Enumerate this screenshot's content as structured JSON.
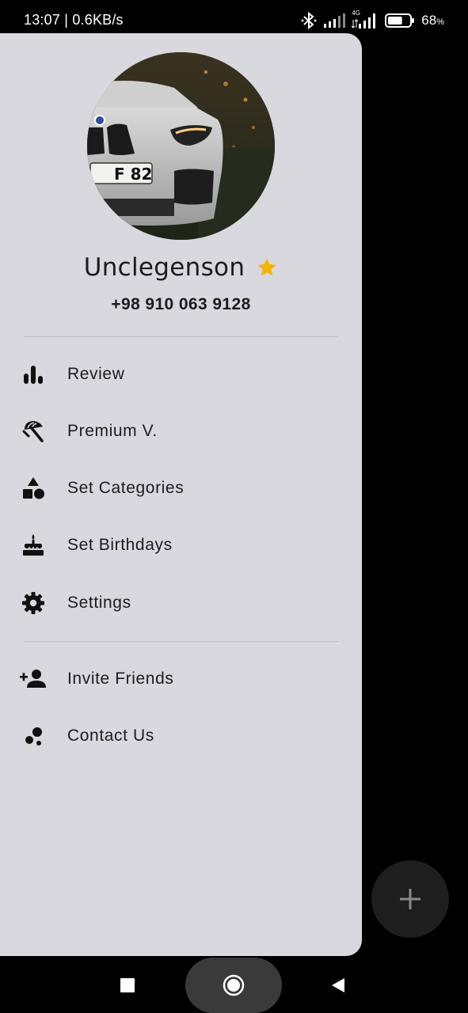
{
  "status_bar": {
    "time": "13:07 | 0.6KB/s",
    "network_label": "4G",
    "battery_percent": "68",
    "battery_unit": "%",
    "battery_level": 0.68
  },
  "profile": {
    "name": "Unclegenson",
    "phone": "+98 910 063 9128",
    "avatar_plate": "F 82",
    "star_color": "#f4b400"
  },
  "menu": {
    "primary": [
      {
        "label": "Review",
        "icon": "bar-chart-icon"
      },
      {
        "label": "Premium V.",
        "icon": "beach-umbrella-icon"
      },
      {
        "label": "Set Categories",
        "icon": "category-shapes-icon"
      },
      {
        "label": "Set Birthdays",
        "icon": "cake-icon"
      },
      {
        "label": "Settings",
        "icon": "gear-icon"
      }
    ],
    "secondary": [
      {
        "label": "Invite Friends",
        "icon": "person-add-icon"
      },
      {
        "label": "Contact Us",
        "icon": "bubble-chart-icon"
      }
    ]
  },
  "fab": {
    "icon": "plus-icon"
  },
  "nav_bar": {
    "recents_icon": "square-icon",
    "home_icon": "circle-icon",
    "back_icon": "triangle-back-icon"
  },
  "colors": {
    "drawer_bg": "#d9d8de",
    "text": "#1d1b20",
    "fab_bg": "#1e1e1e"
  }
}
